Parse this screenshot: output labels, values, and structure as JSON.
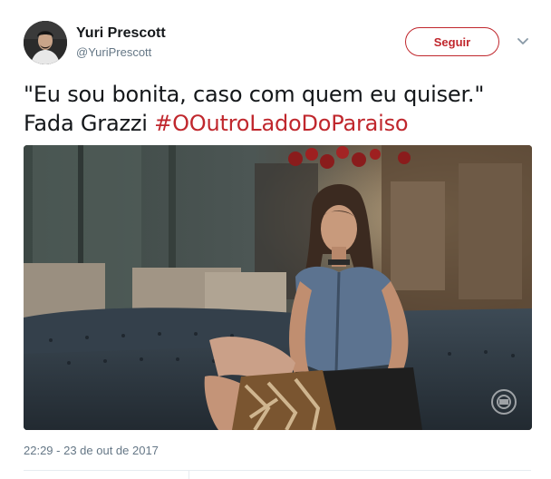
{
  "author": {
    "name": "Yuri Prescott",
    "handle": "@YuriPrescott"
  },
  "follow_button": {
    "label": "Seguir"
  },
  "tweet": {
    "text_line1": "\"Eu sou bonita, caso com quem eu quiser.\"",
    "text_prefix": "Fada Grazzi ",
    "hashtag": "#OOutroLadoDoParaiso",
    "timestamp": "22:29 - 23 de out de 2017"
  },
  "colors": {
    "accent": "#c0272d",
    "secondary_text": "#657786",
    "primary_text": "#14171a",
    "divider": "#e6ecf0"
  },
  "icons": {
    "caret": "chevron-down-icon",
    "watermark": "globo-logo-icon"
  }
}
